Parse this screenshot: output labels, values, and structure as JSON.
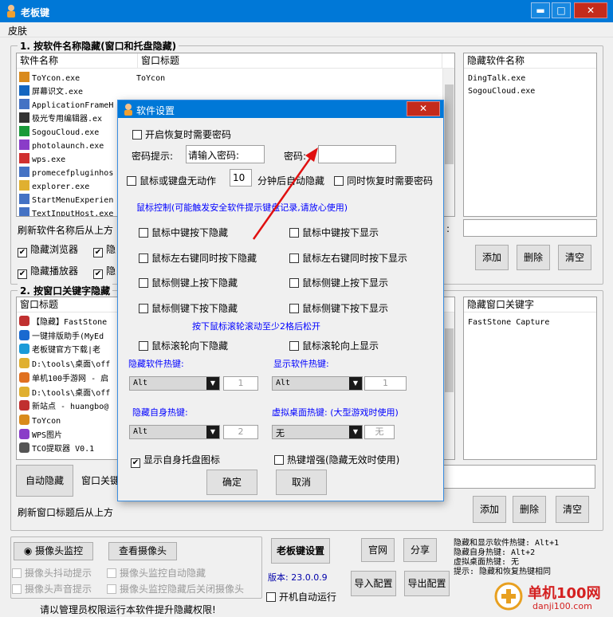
{
  "app": {
    "title": "老板键",
    "menu": "皮肤"
  },
  "group1": {
    "title": "1. 按软件名称隐藏(窗口和托盘隐藏)",
    "col_name": "软件名称",
    "col_title": "窗口标题",
    "rows": [
      {
        "name": "ToYcon.exe",
        "title": "ToYcon",
        "color": "#d98a1c"
      },
      {
        "name": "屏幕识文.exe",
        "title": "",
        "color": "#1466c0"
      },
      {
        "name": "ApplicationFrameH",
        "title": "",
        "color": "#4472c4"
      },
      {
        "name": "极光专用编辑器.ex",
        "title": "",
        "color": "#333333"
      },
      {
        "name": "SogouCloud.exe",
        "title": "",
        "color": "#1a9a3a"
      },
      {
        "name": "photolaunch.exe",
        "title": "",
        "color": "#8a3cc8"
      },
      {
        "name": "wps.exe",
        "title": "",
        "color": "#d03030"
      },
      {
        "name": "promecefpluginhos",
        "title": "",
        "color": "#4472c4"
      },
      {
        "name": "explorer.exe",
        "title": "",
        "color": "#e0b030"
      },
      {
        "name": "StartMenuExperien",
        "title": "",
        "color": "#4472c4"
      },
      {
        "name": "TextInputHost.exe",
        "title": "",
        "color": "#4472c4"
      }
    ],
    "hidden_header": "隐藏软件名称",
    "hidden_items": [
      "DingTalk.exe",
      "SogouCloud.exe"
    ],
    "refresh_text": "刷新软件名称后从上方",
    "cb_browser": "隐藏浏览器",
    "cb_player": "隐藏播放器",
    "cb_partial1": "隐",
    "cb_partial2": "隐",
    "add": "添加",
    "delete": "删除",
    "clear": "清空"
  },
  "group2": {
    "title": "2. 按窗口关键字隐藏",
    "col_title": "窗口标题",
    "rows": [
      {
        "text": "【隐藏】FastStone",
        "color": "#c03030"
      },
      {
        "text": "一键排版助手(MyEd",
        "color": "#1a6ad0"
      },
      {
        "text": "老板键官方下载|老",
        "color": "#1a9ad8"
      },
      {
        "text": "D:\\tools\\桌面\\off",
        "color": "#e0b030"
      },
      {
        "text": "单机100手游网 - 启",
        "color": "#e07020"
      },
      {
        "text": "D:\\tools\\桌面\\off",
        "color": "#e0b030"
      },
      {
        "text": "新站点 - huangbo@",
        "color": "#c03030"
      },
      {
        "text": "ToYcon",
        "color": "#d98a1c"
      },
      {
        "text": "WPS图片",
        "color": "#8a3cc8"
      },
      {
        "text": "TCO提取器 V0.1",
        "color": "#555555"
      }
    ],
    "kw_header": "隐藏窗口关键字",
    "kw_items": [
      "FastStone Capture"
    ],
    "auto_hide": "自动隐藏",
    "keyword_label": "窗口关键",
    "refresh_text": "刷新窗口标题后从上方",
    "add": "添加",
    "delete": "删除",
    "clear": "清空"
  },
  "bottom": {
    "camera_monitor": "摄像头监控",
    "view_camera": "查看摄像头",
    "cb_shake": "摄像头抖动提示",
    "cb_sound": "摄像头声音提示",
    "cb_auto_hide": "摄像头监控自动隐藏",
    "cb_close_after": "摄像头监控隐藏后关闭摄像头",
    "settings": "老板键设置",
    "version": "版本: 23.0.0.9",
    "cb_autostart": "开机自动运行",
    "website": "官网",
    "share": "分享",
    "import": "导入配置",
    "export": "导出配置",
    "info": [
      "隐藏和显示软件热键: Alt+1",
      "隐藏自身热键: Alt+2",
      "虚拟桌面热键: 无",
      "提示: 隐藏和恢复热键相同"
    ],
    "admin_note": "请以管理员权限运行本软件提升隐藏权限!"
  },
  "dialog": {
    "title": "软件设置",
    "cb_password": "开启恢复时需要密码",
    "hint_label": "密码提示:",
    "hint_value": "请输入密码:",
    "pwd_label": "密码:",
    "pwd_value": "",
    "cb_idle": "鼠标或键盘无动作",
    "idle_minutes": "10",
    "idle_suffix": "分钟后自动隐藏",
    "cb_restore_pwd": "同时恢复时需要密码",
    "mouse_section": "鼠标控制(可能触发安全软件提示键盘记录,请放心使用)",
    "left_items": [
      "鼠标中键按下隐藏",
      "鼠标左右键同时按下隐藏",
      "鼠标侧键上按下隐藏",
      "鼠标侧键下按下隐藏"
    ],
    "right_items": [
      "鼠标中键按下显示",
      "鼠标左右键同时按下显示",
      "鼠标侧键上按下显示",
      "鼠标侧键下按下显示"
    ],
    "wheel_note": "按下鼠标滚轮滚动至少2格后松开",
    "wheel_down": "鼠标滚轮向下隐藏",
    "wheel_up": "鼠标滚轮向上显示",
    "hide_hotkey_label": "隐藏软件热键:",
    "hide_mod": "Alt",
    "hide_key": "1",
    "show_hotkey_label": "显示软件热键:",
    "show_mod": "Alt",
    "show_key": "1",
    "self_hotkey_label": "隐藏自身热键:",
    "self_mod": "Alt",
    "self_key": "2",
    "vd_hotkey_label": "虚拟桌面热键: (大型游戏时使用)",
    "vd_mod": "无",
    "vd_key": "无",
    "cb_tray": "显示自身托盘图标",
    "cb_enhance": "热键增强(隐藏无效时使用)",
    "ok": "确定",
    "cancel": "取消"
  },
  "watermark": {
    "text": "单机100网",
    "sub": "danji100.com"
  }
}
